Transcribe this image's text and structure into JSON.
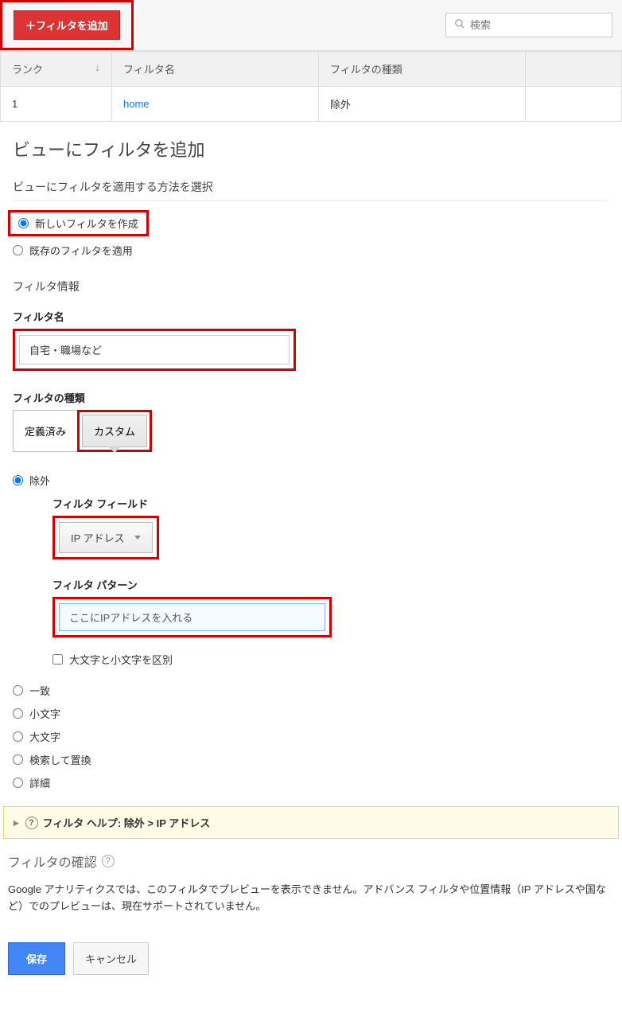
{
  "toolbar": {
    "add_filter_label": "＋フィルタを追加",
    "search_placeholder": "検索"
  },
  "table": {
    "col_rank": "ランク",
    "col_name": "フィルタ名",
    "col_type": "フィルタの種類",
    "row1_rank": "1",
    "row1_name": "home",
    "row1_type": "除外"
  },
  "page": {
    "title": "ビューにフィルタを追加",
    "method_label": "ビューにフィルタを適用する方法を選択",
    "opt_create_new": "新しいフィルタを作成",
    "opt_apply_existing": "既存のフィルタを適用",
    "filter_info_label": "フィルタ情報",
    "filter_name_label": "フィルタ名",
    "filter_name_value": "自宅・職場など",
    "filter_type_label": "フィルタの種類",
    "seg_predefined": "定義済み",
    "seg_custom": "カスタム",
    "opt_exclude": "除外",
    "field_label": "フィルタ フィールド",
    "field_value": "IP アドレス",
    "pattern_label": "フィルタ パターン",
    "pattern_value": "ここにIPアドレスを入れる",
    "cb_case": "大文字と小文字を区別",
    "opt_include": "一致",
    "opt_lower": "小文字",
    "opt_upper": "大文字",
    "opt_search_replace": "検索して置換",
    "opt_advanced": "詳細"
  },
  "help": {
    "banner_text": "フィルタ ヘルプ: 除外  >  IP アドレス"
  },
  "confirm": {
    "title": "フィルタの確認",
    "desc": "Google アナリティクスでは、このフィルタでプレビューを表示できません。アドバンス フィルタや位置情報（IP アドレスや国など）でのプレビューは、現在サポートされていません。"
  },
  "footer": {
    "save": "保存",
    "cancel": "キャンセル"
  }
}
